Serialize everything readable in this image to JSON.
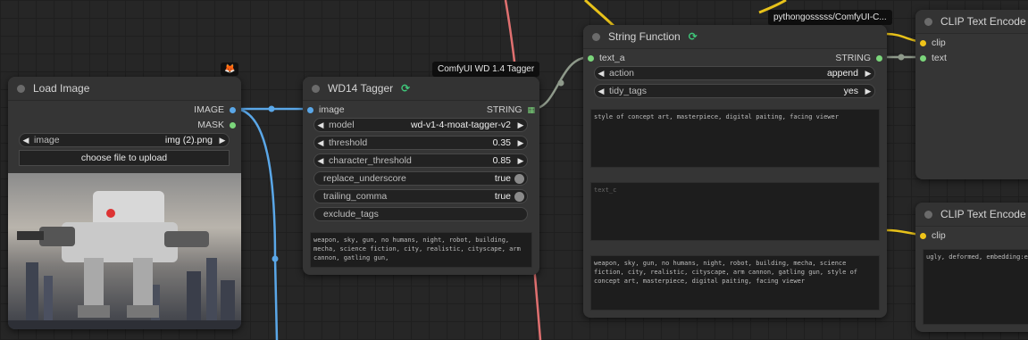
{
  "nodes": {
    "load_image": {
      "title": "Load Image",
      "outputs": [
        "IMAGE",
        "MASK"
      ],
      "image_widget": {
        "name": "image",
        "value": "img (2).png"
      },
      "upload_label": "choose file to upload",
      "preview_icon": "mecha-robot-preview"
    },
    "wd14": {
      "title": "WD14 Tagger",
      "badge": "ComfyUI WD 1.4 Tagger",
      "input": "image",
      "output": "STRING",
      "widgets": [
        {
          "name": "model",
          "value": "wd-v1-4-moat-tagger-v2"
        },
        {
          "name": "threshold",
          "value": "0.35"
        },
        {
          "name": "character_threshold",
          "value": "0.85"
        },
        {
          "name": "replace_underscore",
          "value": "true"
        },
        {
          "name": "trailing_comma",
          "value": "true"
        },
        {
          "name": "exclude_tags",
          "value": ""
        }
      ],
      "output_text": "weapon, sky, gun, no humans, night, robot, building, mecha, science fiction, city, realistic, cityscape, arm cannon, gatling gun,"
    },
    "string_fn": {
      "title": "String Function",
      "badge": "pythongosssss/ComfyUI-C...",
      "input": "text_a",
      "output": "STRING",
      "widgets": [
        {
          "name": "action",
          "value": "append"
        },
        {
          "name": "tidy_tags",
          "value": "yes"
        }
      ],
      "text_b": "style of concept art, masterpiece, digital paiting, facing viewer",
      "text_c_placeholder": "text_c",
      "result": "weapon, sky, gun, no humans, night, robot, building, mecha, science fiction, city, realistic, cityscape, arm cannon, gatling gun, style of concept art, masterpiece, digital paiting, facing viewer"
    },
    "clip1": {
      "title": "CLIP Text Encode (",
      "inputs": [
        "clip",
        "text"
      ]
    },
    "clip2": {
      "title": "CLIP Text Encode (",
      "inputs": [
        "clip"
      ],
      "text": "ugly, deformed, embedding:ea"
    }
  },
  "colors": {
    "image_wire": "#5aa7e8",
    "string_wire": "#8f9a8b",
    "clip_wire": "#f0c419",
    "model_wire": "#e07070",
    "green_port": "#7bd67b",
    "yellow_port": "#f0c419"
  }
}
